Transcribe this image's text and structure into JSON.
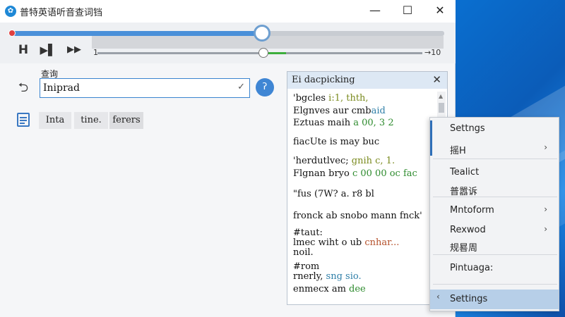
{
  "window": {
    "title": "普特英语听音查词铛",
    "min_label": "—",
    "max_label": "☐",
    "close_label": "✕"
  },
  "player": {
    "top_progress": 0.58,
    "controls": [
      {
        "name": "stop-button",
        "icon": "stop-icon",
        "glyph": "H"
      },
      {
        "name": "play-next-button",
        "icon": "play-next-icon",
        "glyph": "▶▌"
      },
      {
        "name": "fast-forward-button",
        "icon": "fast-forward-icon",
        "glyph": "▶▶"
      }
    ],
    "scrub_start": "1",
    "scrub_end": "10",
    "scrub_progress": 0.51,
    "scrub_green_fraction": 0.07
  },
  "search": {
    "label": "查询",
    "value": "Iniprad",
    "check_icon": "✓",
    "go_icon": "ʔ"
  },
  "tabs": [
    {
      "label": "Inta"
    },
    {
      "label": "tine."
    },
    {
      "label": "ferers"
    }
  ],
  "dict": {
    "title": "Ei dacpicking",
    "lines": [
      {
        "parts": [
          {
            "t": "'bgcles ",
            "c": ""
          },
          {
            "t": "i:1, thth,",
            "c": "olive"
          }
        ]
      },
      {
        "parts": [
          {
            "t": "Elgnves aur cmb",
            "c": ""
          },
          {
            "t": "aid",
            "c": "teal"
          }
        ]
      },
      {
        "parts": [
          {
            "t": "Eztuas maih ",
            "c": ""
          },
          {
            "t": "a 00, 3 2",
            "c": "green"
          }
        ]
      },
      {
        "parts": [
          {
            "t": "fiacUte is may buc",
            "c": ""
          }
        ]
      },
      {
        "parts": [
          {
            "t": "'herdutlvec; ",
            "c": ""
          },
          {
            "t": "gnih c, 1.",
            "c": "olive"
          }
        ]
      },
      {
        "parts": [
          {
            "t": "Flgnan bryo ",
            "c": ""
          },
          {
            "t": "c 00 00 oc fac",
            "c": "green"
          }
        ]
      },
      {
        "parts": [
          {
            "t": "\"fus (7W? a. r8 bl",
            "c": ""
          }
        ]
      },
      {
        "parts": [
          {
            "t": "fronck ab snobo mann fnck'",
            "c": ""
          }
        ]
      },
      {
        "parts": [
          {
            "t": "#taut:",
            "c": ""
          }
        ]
      },
      {
        "parts": [
          {
            "t": "lmec wiht o ub ",
            "c": ""
          },
          {
            "t": "cnhar...",
            "c": "brown"
          }
        ]
      },
      {
        "parts": [
          {
            "t": "noil.",
            "c": ""
          }
        ]
      },
      {
        "parts": [
          {
            "t": "#rom",
            "c": ""
          }
        ]
      },
      {
        "parts": [
          {
            "t": "rnerly, ",
            "c": ""
          },
          {
            "t": "sng sio.",
            "c": "teal"
          }
        ]
      },
      {
        "parts": [
          {
            "t": "enmecx am ",
            "c": ""
          },
          {
            "t": "dee",
            "c": "green"
          }
        ]
      }
    ]
  },
  "menu": {
    "items": [
      {
        "label": "Settngs",
        "arrow": ""
      },
      {
        "label": "摇H",
        "arrow": "›"
      },
      {
        "label": "Tealict",
        "arrow": ""
      },
      {
        "label": "普嚣诉",
        "arrow": ""
      },
      {
        "label": "Mntoform",
        "arrow": "›"
      },
      {
        "label": "Rexwod",
        "arrow": "›"
      },
      {
        "label": "规晷周",
        "arrow": ""
      },
      {
        "label": "Pintuaga:",
        "arrow": ""
      },
      {
        "label": "Settings",
        "arrow": "",
        "left_arrow": "‹"
      }
    ]
  },
  "colors": {
    "accent": "#3f86d4",
    "menu_selected": "#b7cfe8",
    "desktop_blue": "#0b5cb8"
  }
}
